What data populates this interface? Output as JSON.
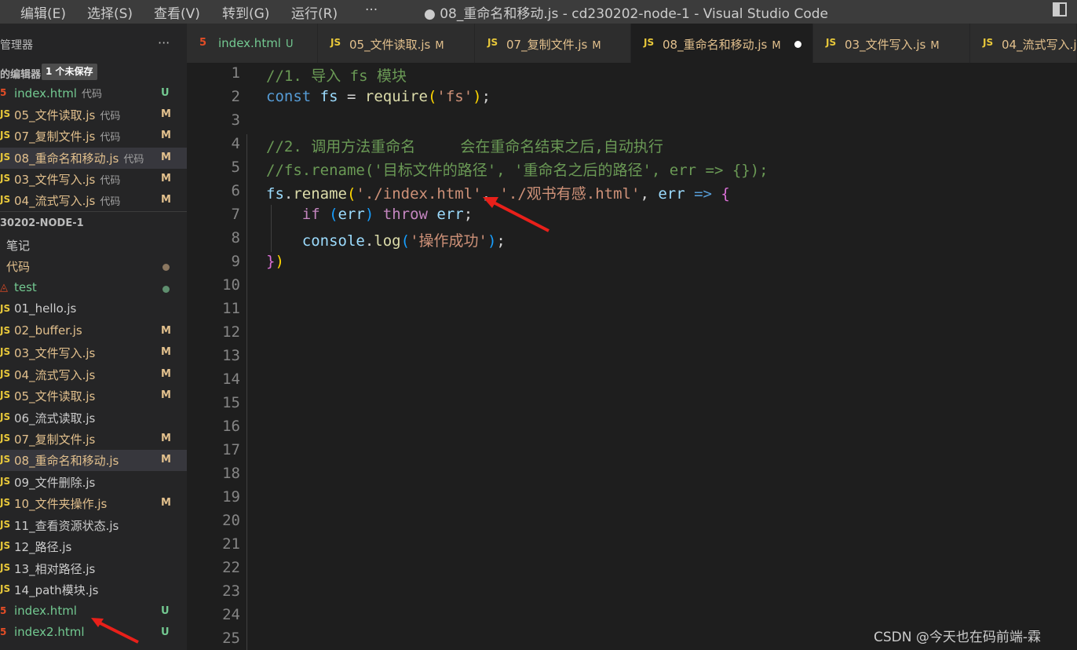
{
  "titlebar": {
    "menu": [
      "编辑(E)",
      "选择(S)",
      "查看(V)",
      "转到(G)",
      "运行(R)",
      "···"
    ],
    "title": "● 08_重命名和移动.js - cd230202-node-1 - Visual Studio Code"
  },
  "sidebar": {
    "explorer_label": "管理器",
    "more": "···",
    "open_editors_label": "的编辑器",
    "unsaved_badge": "1 个未保存",
    "open_editors": [
      {
        "icon": "5",
        "name": "index.html",
        "desc": "代码",
        "status": "U"
      },
      {
        "icon": "JS",
        "name": "05_文件读取.js",
        "desc": "代码",
        "status": "M"
      },
      {
        "icon": "JS",
        "name": "07_复制文件.js",
        "desc": "代码",
        "status": "M"
      },
      {
        "icon": "JS",
        "name": "08_重命名和移动.js",
        "desc": "代码",
        "status": "M"
      },
      {
        "icon": "JS",
        "name": "03_文件写入.js",
        "desc": "代码",
        "status": "M"
      },
      {
        "icon": "JS",
        "name": "04_流式写入.js",
        "desc": "代码",
        "status": "M"
      }
    ],
    "project_label": "30202-NODE-1",
    "tree": [
      {
        "name": "笔记",
        "status": ""
      },
      {
        "name": "代码",
        "status": "dot"
      },
      {
        "name": "test",
        "status": "dot"
      },
      {
        "name": "01_hello.js",
        "status": ""
      },
      {
        "name": "02_buffer.js",
        "status": "M"
      },
      {
        "name": "03_文件写入.js",
        "status": "M"
      },
      {
        "name": "04_流式写入.js",
        "status": "M"
      },
      {
        "name": "05_文件读取.js",
        "status": "M"
      },
      {
        "name": "06_流式读取.js",
        "status": ""
      },
      {
        "name": "07_复制文件.js",
        "status": "M"
      },
      {
        "name": "08_重命名和移动.js",
        "status": "M"
      },
      {
        "name": "09_文件删除.js",
        "status": ""
      },
      {
        "name": "10_文件夹操作.js",
        "status": "M"
      },
      {
        "name": "11_查看资源状态.js",
        "status": ""
      },
      {
        "name": "12_路径.js",
        "status": ""
      },
      {
        "name": "13_相对路径.js",
        "status": ""
      },
      {
        "name": "14_path模块.js",
        "status": ""
      },
      {
        "name": "index.html",
        "status": "U"
      },
      {
        "name": "index2.html",
        "status": "U"
      }
    ]
  },
  "tabs": [
    {
      "icon": "5",
      "label": "index.html",
      "status": "U"
    },
    {
      "icon": "JS",
      "label": "05_文件读取.js",
      "status": "M"
    },
    {
      "icon": "JS",
      "label": "07_复制文件.js",
      "status": "M"
    },
    {
      "icon": "JS",
      "label": "08_重命名和移动.js",
      "status": "M"
    },
    {
      "icon": "JS",
      "label": "03_文件写入.js",
      "status": "M"
    },
    {
      "icon": "JS",
      "label": "04_流式写入.j",
      "status": ""
    }
  ],
  "editor": {
    "line_numbers": [
      "1",
      "2",
      "3",
      "4",
      "5",
      "6",
      "7",
      "8",
      "9",
      "10",
      "11",
      "12",
      "13",
      "14",
      "15",
      "16",
      "17",
      "18",
      "19",
      "20",
      "21",
      "22",
      "23",
      "24",
      "25"
    ],
    "line1": "//1. 导入 fs 模块",
    "line2": {
      "kw": "const",
      "var": "fs",
      "eq": " = ",
      "fn": "require",
      "p1": "(",
      "str": "'fs'",
      "p2": ")",
      "end": ";"
    },
    "line4": "//2. 调用方法重命名     会在重命名结束之后,自动执行",
    "line5": "//fs.rename('目标文件的路径', '重命名之后的路径', err => {});",
    "line6": {
      "obj": "fs",
      "dot": ".",
      "fn": "rename",
      "p1": "(",
      "s1": "'./index.html'",
      "comma": ", ",
      "s2": "'./观书有感.html'",
      "comma2": ", ",
      "arg": "err",
      "arrow": " => ",
      "brace": "{"
    },
    "line7": {
      "kw": "if",
      "p1": " (",
      "var": "err",
      "p2": ") ",
      "kw2": "throw",
      "var2": " err",
      "end": ";"
    },
    "line8": {
      "obj": "console",
      "dot": ".",
      "fn": "log",
      "p1": "(",
      "str": "'操作成功'",
      "p2": ")",
      "end": ";"
    },
    "line9": {
      "brace": "}",
      "paren": ")"
    }
  },
  "watermark": "CSDN @今天也在码前端-霖"
}
